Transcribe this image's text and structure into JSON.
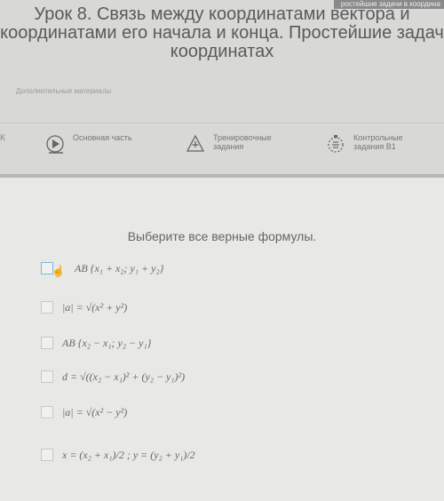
{
  "top_strip": "ростейшие задачи в координа",
  "lesson": {
    "title_line1": "Урок 8. Связь между координатами вектора и",
    "title_line2": "координатами его начала и конца. Простейшие задач",
    "title_line3": "координатах"
  },
  "extra_materials": "Дополнительные материалы",
  "back_arrow": "К",
  "tabs": [
    {
      "label_line1": "Основная часть",
      "label_line2": ""
    },
    {
      "label_line1": "Тренировочные",
      "label_line2": "задания"
    },
    {
      "label_line1": "Контрольные",
      "label_line2": "задания В1"
    }
  ],
  "question": "Выберите все верные формулы.",
  "options": [
    {
      "formula": "AB {x₁ + x₂; y₁ + y₂}"
    },
    {
      "formula": "|a| = √(x² + y²)"
    },
    {
      "formula": "AB {x₂ − x₁; y₂ − y₁}"
    },
    {
      "formula": "d = √((x₂ − x₁)² + (y₂ − y₁)²)"
    },
    {
      "formula": "|a| = √(x² − y²)"
    },
    {
      "formula": "x = (x₂ + x₁)/2 ; y = (y₂ + y₁)/2"
    }
  ]
}
